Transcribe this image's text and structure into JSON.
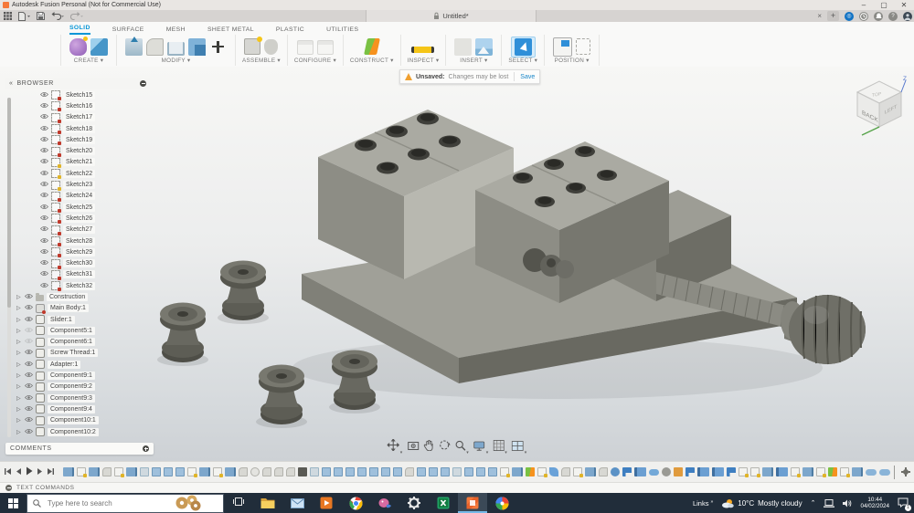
{
  "title_bar": {
    "app_title": "Autodesk Fusion Personal (Not for Commercial Use)"
  },
  "tab_bar": {
    "quick_access": [
      "show-data-panel",
      "file-menu",
      "save",
      "undo",
      "redo"
    ],
    "document_tab": "Untitled*",
    "right_icons": [
      "extensions",
      "job-status",
      "notifications",
      "help",
      "profile"
    ],
    "close_all_label": "×",
    "new_tab_label": "+"
  },
  "toolbar": {
    "tabs": [
      "SOLID",
      "SURFACE",
      "MESH",
      "SHEET METAL",
      "PLASTIC",
      "UTILITIES"
    ],
    "active_tab": "SOLID",
    "groups": [
      {
        "label": "CREATE"
      },
      {
        "label": "MODIFY"
      },
      {
        "label": "ASSEMBLE"
      },
      {
        "label": "CONFIGURE"
      },
      {
        "label": "CONSTRUCT"
      },
      {
        "label": "INSPECT"
      },
      {
        "label": "INSERT"
      },
      {
        "label": "SELECT"
      },
      {
        "label": "POSITION"
      }
    ],
    "dropdown_glyph": "▾"
  },
  "notification": {
    "label": "Unsaved:",
    "message": "Changes may be lost",
    "action": "Save"
  },
  "browser": {
    "header": "BROWSER",
    "items": [
      {
        "label": "Sketch15",
        "kind": "sketch",
        "badge": "red"
      },
      {
        "label": "Sketch16",
        "kind": "sketch",
        "badge": "red"
      },
      {
        "label": "Sketch17",
        "kind": "sketch",
        "badge": "red"
      },
      {
        "label": "Sketch18",
        "kind": "sketch",
        "badge": "red"
      },
      {
        "label": "Sketch19",
        "kind": "sketch",
        "badge": "red"
      },
      {
        "label": "Sketch20",
        "kind": "sketch",
        "badge": "red"
      },
      {
        "label": "Sketch21",
        "kind": "sketch",
        "badge": "yellow"
      },
      {
        "label": "Sketch22",
        "kind": "sketch",
        "badge": "yellow"
      },
      {
        "label": "Sketch23",
        "kind": "sketch",
        "badge": "yellow"
      },
      {
        "label": "Sketch24",
        "kind": "sketch",
        "badge": "red"
      },
      {
        "label": "Sketch25",
        "kind": "sketch",
        "badge": "red"
      },
      {
        "label": "Sketch26",
        "kind": "sketch",
        "badge": "red"
      },
      {
        "label": "Sketch27",
        "kind": "sketch",
        "badge": "red"
      },
      {
        "label": "Sketch28",
        "kind": "sketch",
        "badge": "red"
      },
      {
        "label": "Sketch29",
        "kind": "sketch",
        "badge": "red"
      },
      {
        "label": "Sketch30",
        "kind": "sketch",
        "badge": "red"
      },
      {
        "label": "Sketch31",
        "kind": "sketch",
        "badge": "red"
      },
      {
        "label": "Sketch32",
        "kind": "sketch",
        "badge": "red"
      },
      {
        "label": "Construction",
        "kind": "folder",
        "arrow": true
      },
      {
        "label": "Main Body:1",
        "kind": "body",
        "arrow": true
      },
      {
        "label": "Slider:1",
        "kind": "comp",
        "arrow": true
      },
      {
        "label": "Component5:1",
        "kind": "comp",
        "arrow": true,
        "dim": true
      },
      {
        "label": "Component6:1",
        "kind": "comp",
        "arrow": true,
        "dim": true
      },
      {
        "label": "Screw Thread:1",
        "kind": "comp",
        "arrow": true
      },
      {
        "label": "Adapter:1",
        "kind": "comp",
        "arrow": true
      },
      {
        "label": "Component9:1",
        "kind": "comp",
        "arrow": true
      },
      {
        "label": "Component9:2",
        "kind": "comp",
        "arrow": true
      },
      {
        "label": "Component9:3",
        "kind": "comp",
        "arrow": true
      },
      {
        "label": "Component9:4",
        "kind": "comp",
        "arrow": true
      },
      {
        "label": "Component10:1",
        "kind": "comp",
        "arrow": true
      },
      {
        "label": "Component10:2",
        "kind": "comp",
        "arrow": true
      }
    ]
  },
  "viewcube": {
    "front_face": "BACK",
    "right_face": "LEFT",
    "top_face": "TOP",
    "axis_z": "Z"
  },
  "comments": {
    "header": "COMMENTS"
  },
  "nav_bar": {
    "icons": [
      {
        "name": "pan-orbit",
        "dropdown": true
      },
      {
        "name": "look-at",
        "dropdown": false
      },
      {
        "name": "pan",
        "dropdown": false
      },
      {
        "name": "orbit",
        "dropdown": false
      },
      {
        "name": "zoom",
        "dropdown": true
      },
      {
        "name": "display-settings",
        "dropdown": true
      },
      {
        "name": "grid-settings",
        "dropdown": true
      },
      {
        "name": "viewports",
        "dropdown": true
      }
    ]
  },
  "timeline": {
    "playback": [
      "skip-to-start",
      "step-back",
      "play",
      "step-forward",
      "skip-to-end"
    ],
    "icons": [
      "body",
      "sketch",
      "body",
      "fillet",
      "sketch",
      "body",
      "shell",
      "copy",
      "copy",
      "copy",
      "sketch",
      "body",
      "sketch",
      "body",
      "fillet",
      "pattern",
      "fillet",
      "fillet",
      "fillet",
      "move",
      "shell",
      "copy",
      "copy",
      "copy",
      "copy",
      "copy",
      "copy",
      "copy",
      "fillet",
      "copy",
      "copy",
      "copy",
      "shell",
      "copy",
      "copy",
      "copy",
      "sketch",
      "body",
      "construct",
      "sketch",
      "pipe",
      "fillet",
      "sketch",
      "body",
      "fillet",
      "jointorg",
      "flag",
      "joint",
      "link",
      "motion",
      "pin",
      "flag",
      "joint",
      "joint",
      "flag",
      "sketch",
      "sketch",
      "body",
      "joint",
      "sketch",
      "body",
      "sketch",
      "construct",
      "sketch",
      "body",
      "capsule",
      "capsule"
    ]
  },
  "text_commands": {
    "header": "TEXT COMMANDS"
  },
  "taskbar": {
    "search_placeholder": "Type here to search",
    "apps": [
      {
        "name": "file-explorer"
      },
      {
        "name": "mail"
      },
      {
        "name": "movies-tv"
      },
      {
        "name": "chrome"
      },
      {
        "name": "paint-3d"
      },
      {
        "name": "settings"
      },
      {
        "name": "excel"
      },
      {
        "name": "fusion",
        "active": true
      },
      {
        "name": "photos"
      }
    ],
    "links_label": "Links",
    "weather_temp": "10°C",
    "weather_condition": "Mostly cloudy",
    "time": "10:44",
    "date": "04/02/2024"
  },
  "colors": {
    "accent_blue": "#0696d7",
    "save_link_blue": "#1a87c9",
    "warning_orange": "#f0a030",
    "fusion_orange": "#f5793b",
    "taskbar_bg": "#212d3a",
    "viewport_top": "#f7f7f5",
    "viewport_bottom": "#cdd1d5"
  }
}
